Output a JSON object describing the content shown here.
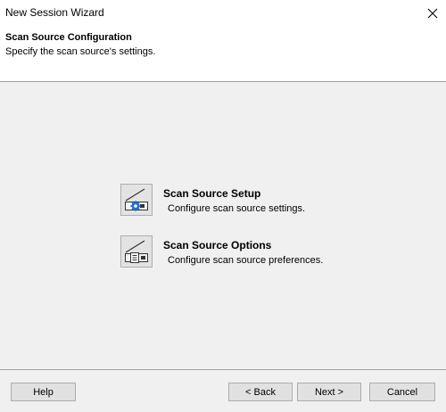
{
  "window": {
    "title": "New Session Wizard",
    "close_icon": "close-icon"
  },
  "header": {
    "title": "Scan Source Configuration",
    "subtitle": "Specify the scan source's settings."
  },
  "options": [
    {
      "title": "Scan Source Setup",
      "description": "Configure scan source settings.",
      "icon": "scanner-settings-icon"
    },
    {
      "title": "Scan Source Options",
      "description": "Configure scan source preferences.",
      "icon": "scanner-options-icon"
    }
  ],
  "footer": {
    "help_label": "Help",
    "back_label": "< Back",
    "next_label": "Next >",
    "cancel_label": "Cancel"
  },
  "colors": {
    "accent_blue": "#1e6fd9",
    "content_bg": "#f0f0f0"
  }
}
